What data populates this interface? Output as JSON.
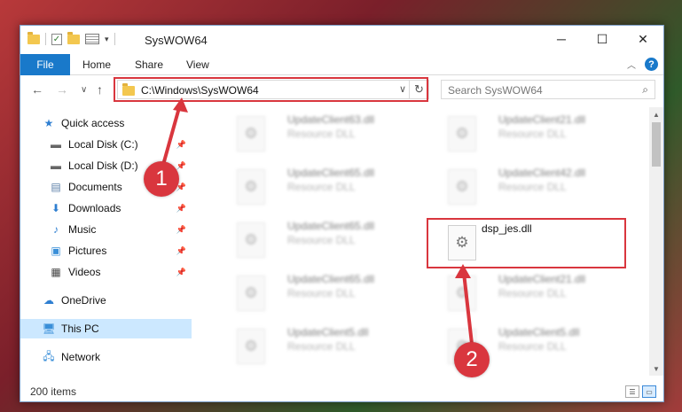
{
  "window": {
    "title": "SysWOW64"
  },
  "ribbon": {
    "tabs": [
      "File",
      "Home",
      "Share",
      "View"
    ],
    "file_color": "#1979ca"
  },
  "address": {
    "path": "C:\\Windows\\SysWOW64"
  },
  "search": {
    "placeholder": "Search SysWOW64"
  },
  "sidebar": {
    "items": [
      {
        "label": "Quick access",
        "icon": "star-icon"
      },
      {
        "label": "Local Disk (C:)",
        "icon": "drive-icon",
        "pinned": true
      },
      {
        "label": "Local Disk (D:)",
        "icon": "drive-icon",
        "pinned": true
      },
      {
        "label": "Documents",
        "icon": "documents-icon",
        "pinned": true
      },
      {
        "label": "Downloads",
        "icon": "download-icon",
        "pinned": true
      },
      {
        "label": "Music",
        "icon": "music-icon",
        "pinned": true
      },
      {
        "label": "Pictures",
        "icon": "pictures-icon",
        "pinned": true
      },
      {
        "label": "Videos",
        "icon": "videos-icon",
        "pinned": true
      },
      {
        "label": "OneDrive",
        "icon": "cloud-icon"
      },
      {
        "label": "This PC",
        "icon": "computer-icon",
        "selected": true
      },
      {
        "label": "Network",
        "icon": "network-icon"
      }
    ]
  },
  "files": [
    {
      "name": "UpdateClient63.dll",
      "type": "Resource DLL"
    },
    {
      "name": "UpdateClient21.dll",
      "type": "Resource DLL"
    },
    {
      "name": "UpdateClient65.dll",
      "type": "Resource DLL"
    },
    {
      "name": "UpdateClient42.dll",
      "type": "Resource DLL"
    },
    {
      "name": "UpdateClient65.dll",
      "type": "Resource DLL"
    },
    {
      "name": "dsp_jes.dll",
      "type": ""
    },
    {
      "name": "UpdateClient65.dll",
      "type": "Resource DLL"
    },
    {
      "name": "UpdateClient21.dll",
      "type": "Resource DLL"
    },
    {
      "name": "UpdateClient5.dll",
      "type": "Resource DLL"
    },
    {
      "name": "UpdateClient5.dll",
      "type": "Resource DLL"
    }
  ],
  "status": {
    "item_count": "200 items"
  },
  "annotations": {
    "badge_1": "1",
    "badge_2": "2",
    "color": "#d9363e"
  }
}
